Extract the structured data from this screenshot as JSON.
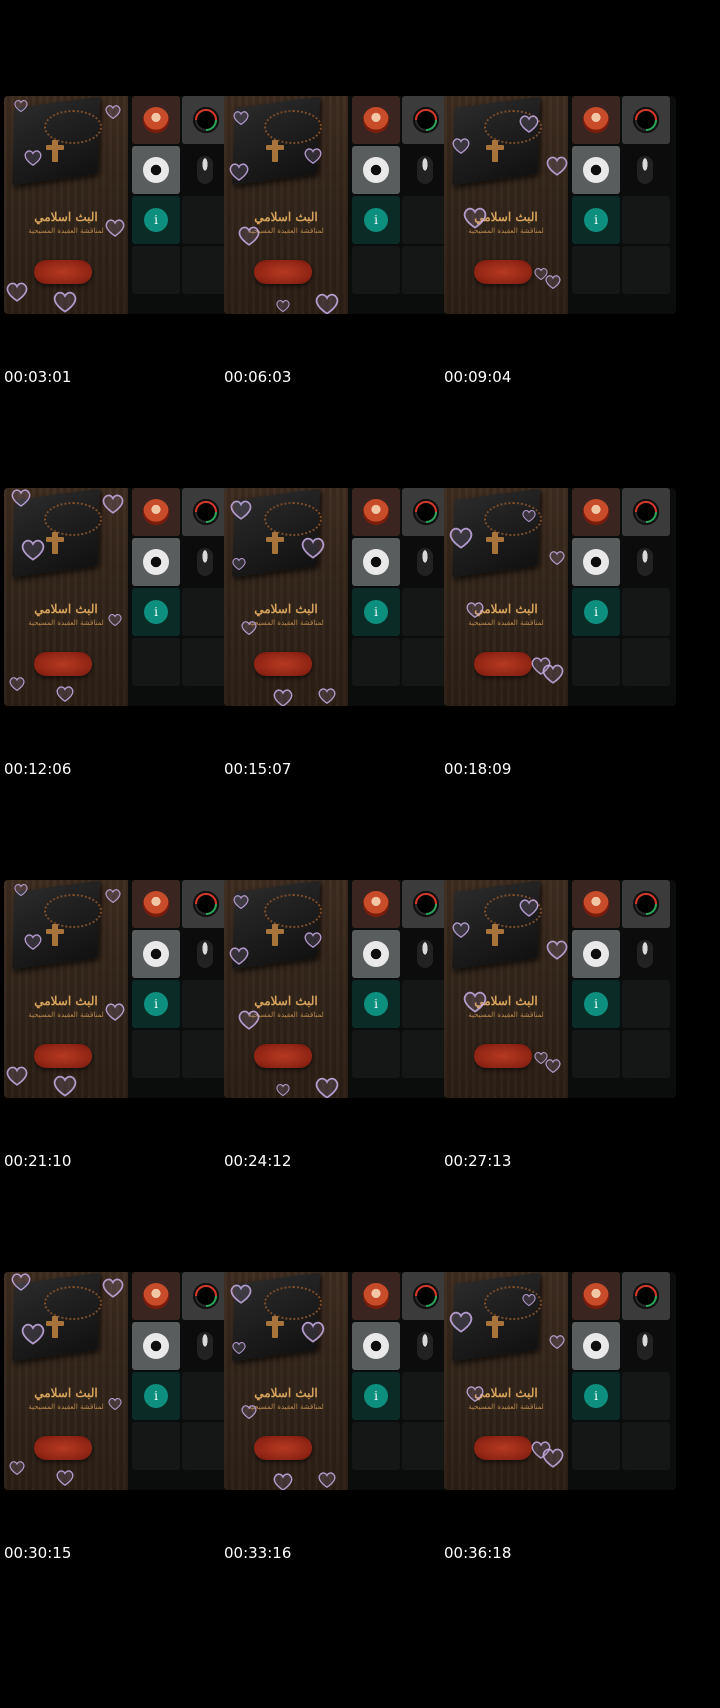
{
  "frames": [
    {
      "timestamp": "00:03:01"
    },
    {
      "timestamp": "00:06:03"
    },
    {
      "timestamp": "00:09:04"
    },
    {
      "timestamp": "00:12:06"
    },
    {
      "timestamp": "00:15:07"
    },
    {
      "timestamp": "00:18:09"
    },
    {
      "timestamp": "00:21:10"
    },
    {
      "timestamp": "00:24:12"
    },
    {
      "timestamp": "00:27:13"
    },
    {
      "timestamp": "00:30:15"
    },
    {
      "timestamp": "00:33:16"
    },
    {
      "timestamp": "00:36:18"
    }
  ],
  "poster": {
    "title": "البث اسلامي",
    "subtitle": "لمناقشة العقيدة المسيحية"
  },
  "info_label": "i",
  "icons": {
    "avatar_1": "user-avatar-icon",
    "avatar_2": "loading-ring-icon",
    "avatar_3": "user-avatar-icon",
    "avatar_4": "user-avatar-icon",
    "info": "info-icon",
    "bubble": "heart-bubble-icon"
  },
  "colors": {
    "background": "#000000",
    "info_accent": "#0c8f7d",
    "poster_text": "#d5a25c",
    "ring_red": "#d6392b",
    "ring_green": "#2aa65a"
  }
}
